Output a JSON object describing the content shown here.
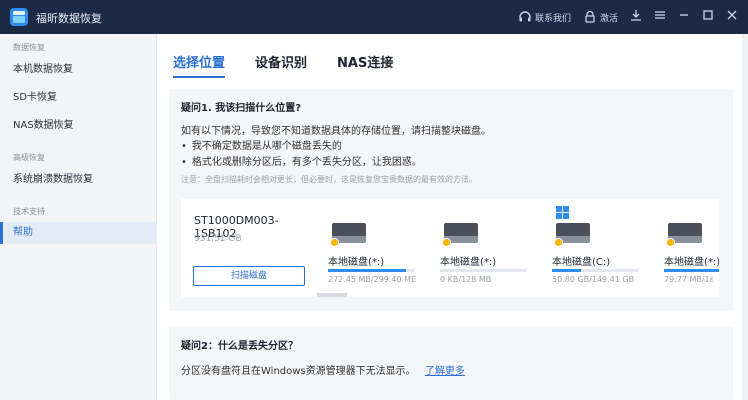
{
  "app": {
    "title": "福昕数据恢复"
  },
  "titlebar": {
    "contact_label": "联系我们",
    "activate_label": "激活"
  },
  "sidebar": {
    "categories": [
      "数据恢复",
      "高级恢复",
      "技术支持"
    ],
    "items": [
      {
        "label": "本机数据恢复"
      },
      {
        "label": "SD卡恢复"
      },
      {
        "label": "NAS数据恢复"
      },
      {
        "label": "系统崩溃数据恢复"
      },
      {
        "label": "帮助"
      }
    ]
  },
  "tabs": [
    "选择位置",
    "设备识别",
    "NAS连接"
  ],
  "faq1": {
    "title": "疑问1. 我该扫描什么位置?",
    "intro": "如有以下情况，导致您不知道数据具体的存储位置，请扫描整块磁盘。",
    "bullets": [
      "我不确定数据是从哪个磁盘丢失的",
      "格式化或删除分区后，有多个丢失分区，让我困惑。"
    ],
    "note": "注意：全盘扫描耗时会相对更长，但必要时，这是恢复您宝贵数据的最有效的方法。"
  },
  "drive": {
    "name": "ST1000DM003-1SB102",
    "size": "931.51 GB",
    "scan_label": "扫描磁盘"
  },
  "partitions": [
    {
      "name": "本地磁盘(*:)",
      "usage": "272.45 MB/299.40 ME",
      "used_fraction": 0.91
    },
    {
      "name": "本地磁盘(*:)",
      "usage": "0 KB/128 MB",
      "used_fraction": 0.0
    },
    {
      "name": "本地磁盘(C:)",
      "usage": "50.80 GB/149.41 GB",
      "used_fraction": 0.34,
      "system": true
    },
    {
      "name": "本地磁盘(*:)",
      "usage": "79.77 MB/1ε",
      "used_fraction": 0.8
    }
  ],
  "faq2": {
    "title": "疑问2：什么是丢失分区？",
    "text": "分区没有盘符且在Windows资源管理器下无法显示。",
    "link": "了解更多"
  },
  "colors": {
    "accent": "#2a6fd6",
    "titlebar": "#1c2a45",
    "warning": "#f5b800"
  }
}
